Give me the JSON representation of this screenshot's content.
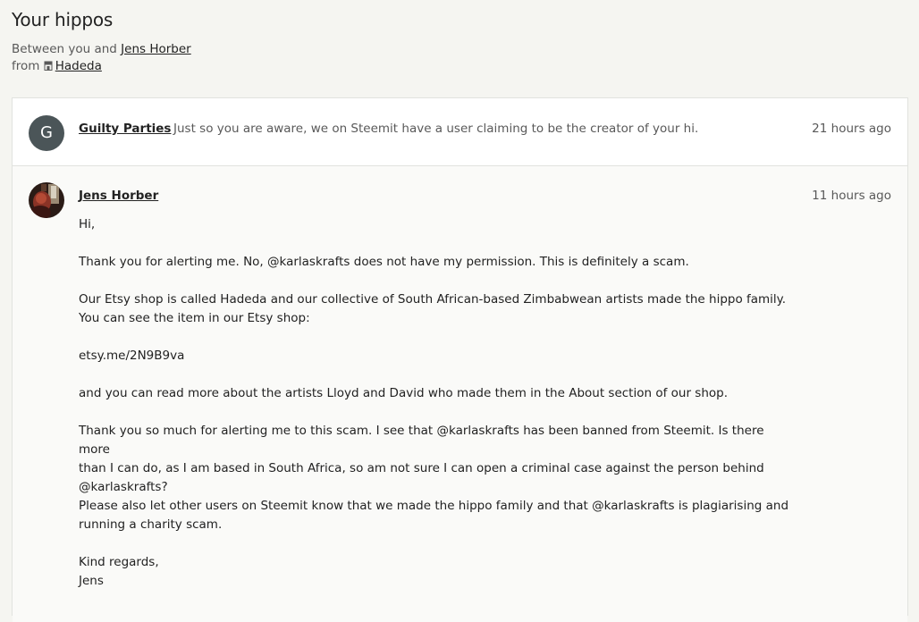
{
  "page": {
    "title": "Your hippos",
    "between_prefix": "Between you and",
    "between_name": "Jens Horber",
    "from_prefix": "from",
    "shop_name": "Hadeda"
  },
  "messages": [
    {
      "avatar_letter": "G",
      "sender": "Guilty Parties",
      "preview": "Just so you are aware, we on Steemit have a user claiming to be the creator of your hi.",
      "time": "21 hours ago"
    },
    {
      "sender": "Jens Horber",
      "time": "11 hours ago",
      "paragraphs": [
        "Hi,",
        "Thank you for alerting me. No, @karlaskrafts does not have my permission. This is definitely a scam.",
        "Our Etsy shop is called Hadeda and our collective of South African-based Zimbabwean artists made the hippo family.\nYou can see the item in our Etsy shop:",
        "etsy.me/2N9B9va",
        "and you can read more about the artists Lloyd and David who made them in the About section of our shop.",
        "Thank you so much for alerting me to this scam. I see that @karlaskrafts has been banned from Steemit. Is there more\nthan I can do, as I am based in South Africa, so am not sure I can open a criminal case against the person behind\n@karlaskrafts?",
        "Please also let other users on Steemit know that we made the hippo family and that @karlaskrafts is plagiarising and\nrunning a charity scam.",
        "Kind regards,\nJens"
      ]
    }
  ]
}
